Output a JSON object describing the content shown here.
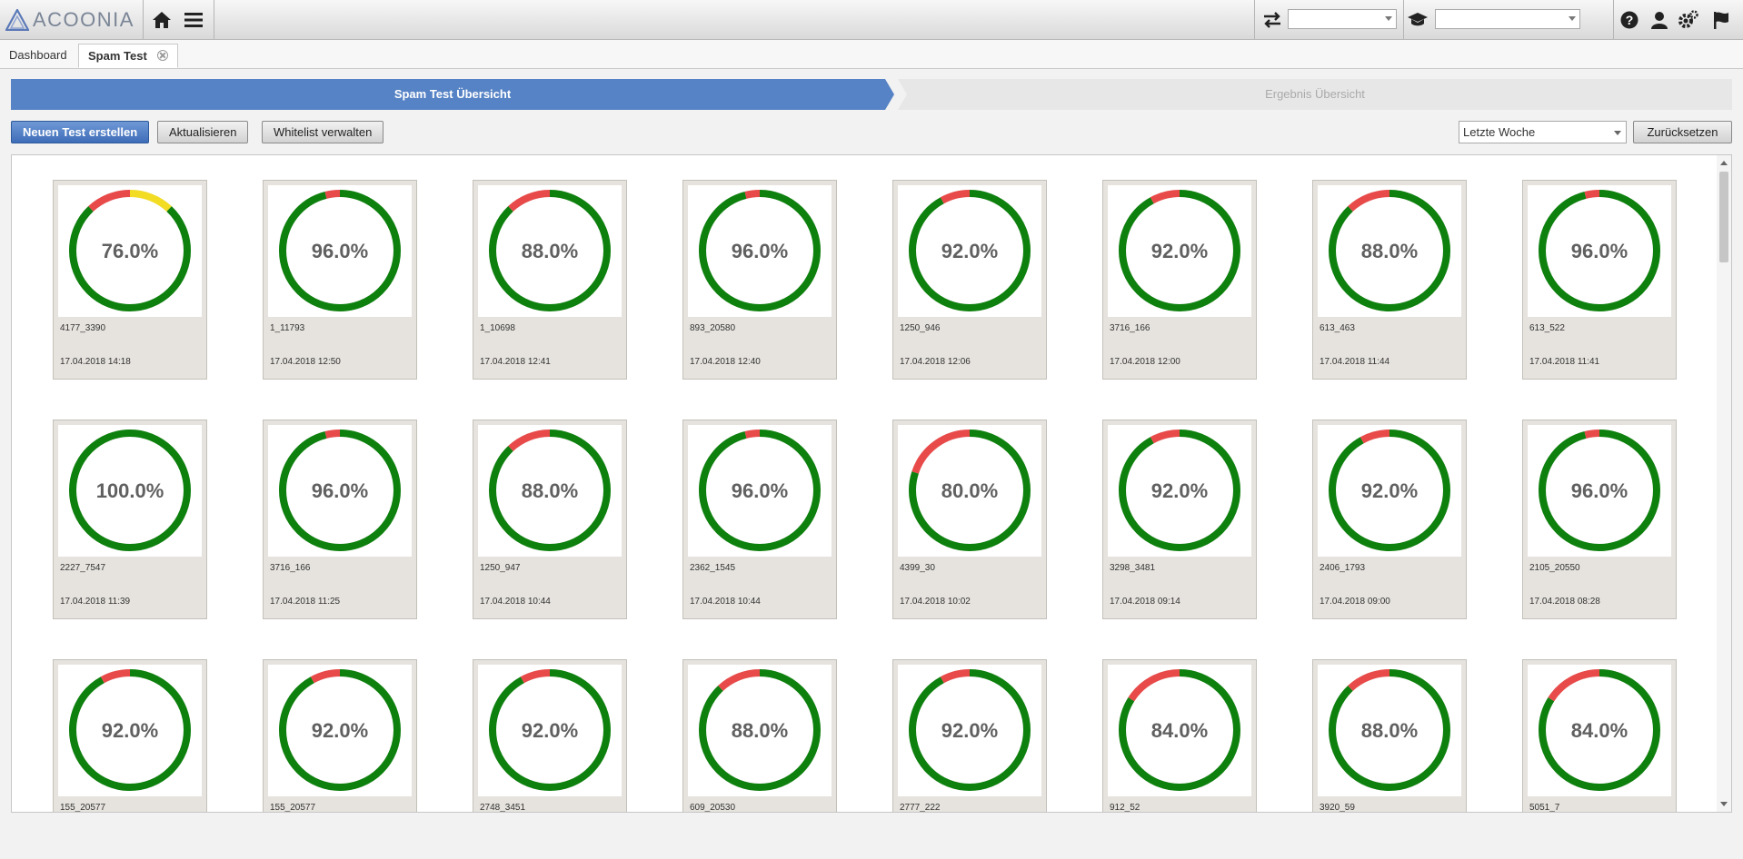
{
  "app": {
    "logo_text": "ACOONIA"
  },
  "topbar": {
    "icons": [
      "home-icon",
      "menu-icon",
      "switch-icon",
      "graduation-cap-icon",
      "help-icon",
      "user-icon",
      "settings-icon",
      "flag-icon"
    ],
    "select1_value": "",
    "select2_value": ""
  },
  "tabs": [
    {
      "label": "Dashboard"
    },
    {
      "label": "Spam Test"
    }
  ],
  "wizard": {
    "step1": "Spam Test Übersicht",
    "step2": "Ergebnis Übersicht"
  },
  "toolbar": {
    "new_test": "Neuen Test erstellen",
    "refresh": "Aktualisieren",
    "whitelist": "Whitelist verwalten",
    "filter_value": "Letzte Woche",
    "reset": "Zurücksetzen"
  },
  "colors": {
    "good": "#0e800e",
    "bad": "#e84a4a",
    "warn": "#f2dc24",
    "accent": "#5683c5"
  },
  "tests": [
    {
      "pct": "76.0%",
      "good": 76,
      "bad": 12,
      "warn": 12,
      "id": "4177_3390",
      "date": "17.04.2018 14:18"
    },
    {
      "pct": "96.0%",
      "good": 96,
      "bad": 4,
      "warn": 0,
      "id": "1_11793",
      "date": "17.04.2018 12:50"
    },
    {
      "pct": "88.0%",
      "good": 88,
      "bad": 12,
      "warn": 0,
      "id": "1_10698",
      "date": "17.04.2018 12:41"
    },
    {
      "pct": "96.0%",
      "good": 96,
      "bad": 4,
      "warn": 0,
      "id": "893_20580",
      "date": "17.04.2018 12:40"
    },
    {
      "pct": "92.0%",
      "good": 92,
      "bad": 8,
      "warn": 0,
      "id": "1250_946",
      "date": "17.04.2018 12:06"
    },
    {
      "pct": "92.0%",
      "good": 92,
      "bad": 8,
      "warn": 0,
      "id": "3716_166",
      "date": "17.04.2018 12:00"
    },
    {
      "pct": "88.0%",
      "good": 88,
      "bad": 12,
      "warn": 0,
      "id": "613_463",
      "date": "17.04.2018 11:44"
    },
    {
      "pct": "96.0%",
      "good": 96,
      "bad": 4,
      "warn": 0,
      "id": "613_522",
      "date": "17.04.2018 11:41"
    },
    {
      "pct": "100.0%",
      "good": 100,
      "bad": 0,
      "warn": 0,
      "id": "2227_7547",
      "date": "17.04.2018 11:39"
    },
    {
      "pct": "96.0%",
      "good": 96,
      "bad": 4,
      "warn": 0,
      "id": "3716_166",
      "date": "17.04.2018 11:25"
    },
    {
      "pct": "88.0%",
      "good": 88,
      "bad": 12,
      "warn": 0,
      "id": "1250_947",
      "date": "17.04.2018 10:44"
    },
    {
      "pct": "96.0%",
      "good": 96,
      "bad": 4,
      "warn": 0,
      "id": "2362_1545",
      "date": "17.04.2018 10:44"
    },
    {
      "pct": "80.0%",
      "good": 80,
      "bad": 20,
      "warn": 0,
      "id": "4399_30",
      "date": "17.04.2018 10:02"
    },
    {
      "pct": "92.0%",
      "good": 92,
      "bad": 8,
      "warn": 0,
      "id": "3298_3481",
      "date": "17.04.2018 09:14"
    },
    {
      "pct": "92.0%",
      "good": 92,
      "bad": 8,
      "warn": 0,
      "id": "2406_1793",
      "date": "17.04.2018 09:00"
    },
    {
      "pct": "96.0%",
      "good": 96,
      "bad": 4,
      "warn": 0,
      "id": "2105_20550",
      "date": "17.04.2018 08:28"
    },
    {
      "pct": "92.0%",
      "good": 92,
      "bad": 8,
      "warn": 0,
      "id": "155_20577",
      "date": ""
    },
    {
      "pct": "92.0%",
      "good": 92,
      "bad": 8,
      "warn": 0,
      "id": "155_20577",
      "date": ""
    },
    {
      "pct": "92.0%",
      "good": 92,
      "bad": 8,
      "warn": 0,
      "id": "2748_3451",
      "date": ""
    },
    {
      "pct": "88.0%",
      "good": 88,
      "bad": 12,
      "warn": 0,
      "id": "609_20530",
      "date": ""
    },
    {
      "pct": "92.0%",
      "good": 92,
      "bad": 8,
      "warn": 0,
      "id": "2777_222",
      "date": ""
    },
    {
      "pct": "84.0%",
      "good": 84,
      "bad": 16,
      "warn": 0,
      "id": "912_52",
      "date": ""
    },
    {
      "pct": "88.0%",
      "good": 88,
      "bad": 12,
      "warn": 0,
      "id": "3920_59",
      "date": ""
    },
    {
      "pct": "84.0%",
      "good": 84,
      "bad": 16,
      "warn": 0,
      "id": "5051_7",
      "date": ""
    }
  ]
}
